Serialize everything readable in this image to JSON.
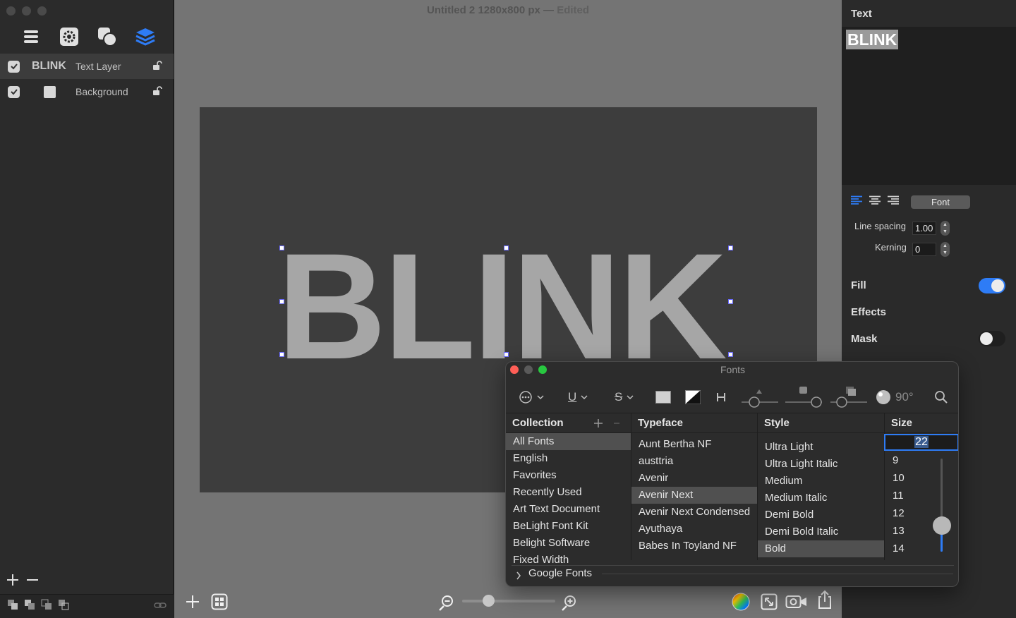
{
  "window": {
    "title": "Untitled 2 1280x800 px",
    "title_sep": "—",
    "status": "Edited"
  },
  "layers": [
    {
      "name": "BLINK",
      "type": "Text Layer",
      "checked": true,
      "selected": true
    },
    {
      "name": "",
      "type": "Background",
      "checked": true,
      "selected": false
    }
  ],
  "canvas": {
    "text": "BLINK"
  },
  "inspector": {
    "title": "Text",
    "preview_text": "BLINK",
    "font_button": "Font",
    "line_spacing_label": "Line spacing",
    "line_spacing_value": "1.00",
    "kerning_label": "Kerning",
    "kerning_value": "0",
    "fill_label": "Fill",
    "fill_on": true,
    "effects_label": "Effects",
    "mask_label": "Mask",
    "mask_on": false,
    "accent": "#2e7cf6"
  },
  "fonts_panel": {
    "title": "Fonts",
    "angle": "90°",
    "columns": {
      "collection": "Collection",
      "typeface": "Typeface",
      "style": "Style",
      "size": "Size"
    },
    "collections": [
      "All Fonts",
      "English",
      "Favorites",
      "Recently Used",
      "Art Text Document",
      "BeLight Font Kit",
      "Belight Software",
      "Fixed Width"
    ],
    "typefaces": [
      "Aunt Bertha NF",
      "austtria",
      "Avenir",
      "Avenir Next",
      "Avenir Next Condensed",
      "Ayuthaya",
      "Babes In Toyland NF"
    ],
    "styles": [
      "Ultra Light",
      "Ultra Light Italic",
      "Medium",
      "Medium Italic",
      "Demi Bold",
      "Demi Bold Italic",
      "Bold"
    ],
    "size_value": "22",
    "sizes": [
      "9",
      "10",
      "11",
      "12",
      "13",
      "14"
    ],
    "google_fonts": "Google Fonts"
  }
}
